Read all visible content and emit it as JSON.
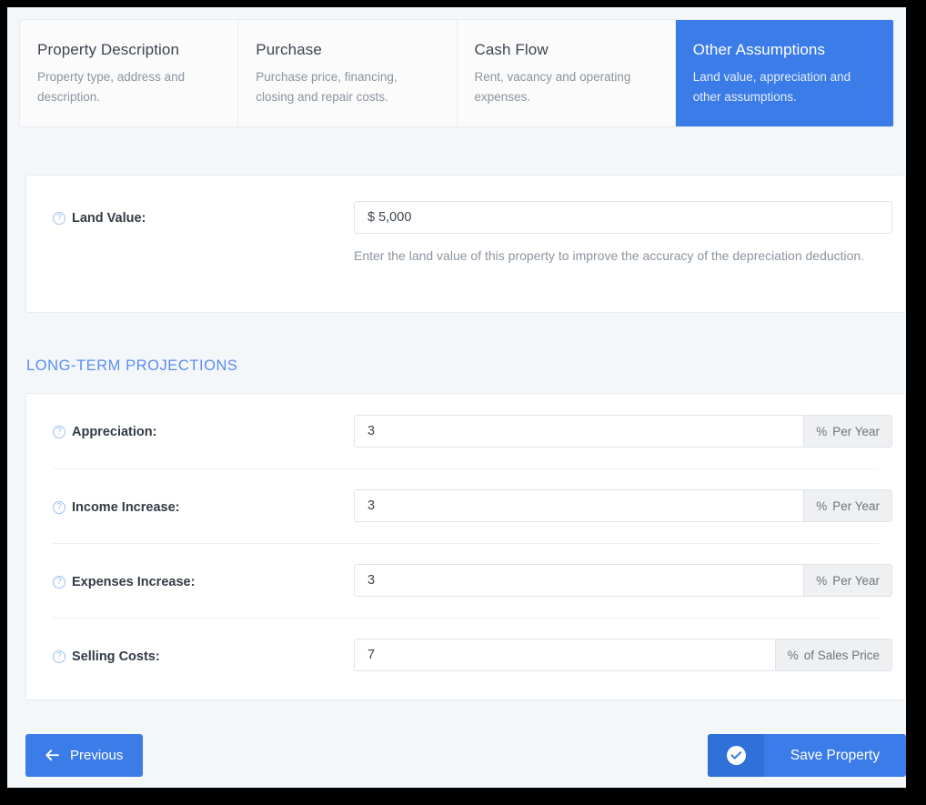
{
  "theme": {
    "accent_blue": "#3b7ce8",
    "accent_blue_dark": "#2f70d9",
    "heading_blue": "#5b8cf0",
    "page_background": "#f4f7fa"
  },
  "tabs": [
    {
      "id": "property-description",
      "title": "Property Description",
      "description": "Property type, address and description.",
      "active": false
    },
    {
      "id": "purchase",
      "title": "Purchase",
      "description": "Purchase price, financing, closing and repair costs.",
      "active": false
    },
    {
      "id": "cash-flow",
      "title": "Cash Flow",
      "description": "Rent, vacancy and operating expenses.",
      "active": false
    },
    {
      "id": "other-assumptions",
      "title": "Other Assumptions",
      "description": "Land value, appreciation and other assumptions.",
      "active": true
    }
  ],
  "land_value": {
    "help_icon": "question-circle-icon",
    "label": "Land Value:",
    "value": "$ 5,000",
    "placeholder": "$ 0",
    "help_text": "Enter the land value of this property to improve the accuracy of the depreciation deduction."
  },
  "projections": {
    "heading": "LONG-TERM PROJECTIONS",
    "rows": [
      {
        "id": "appreciation",
        "help_icon": "question-circle-icon",
        "label": "Appreciation:",
        "value": "3",
        "placeholder": "0",
        "addon_symbol": "%",
        "addon_text": "Per Year"
      },
      {
        "id": "income-increase",
        "help_icon": "question-circle-icon",
        "label": "Income Increase:",
        "value": "3",
        "placeholder": "0",
        "addon_symbol": "%",
        "addon_text": "Per Year"
      },
      {
        "id": "expenses-increase",
        "help_icon": "question-circle-icon",
        "label": "Expenses Increase:",
        "value": "3",
        "placeholder": "0",
        "addon_symbol": "%",
        "addon_text": "Per Year"
      },
      {
        "id": "selling-costs",
        "help_icon": "question-circle-icon",
        "label": "Selling Costs:",
        "value": "7",
        "placeholder": "0",
        "addon_symbol": "%",
        "addon_text": "of Sales Price"
      }
    ]
  },
  "footer": {
    "previous_label": "Previous",
    "previous_icon": "arrow-left-icon",
    "save_label": "Save Property",
    "save_icon": "check-circle-icon"
  }
}
